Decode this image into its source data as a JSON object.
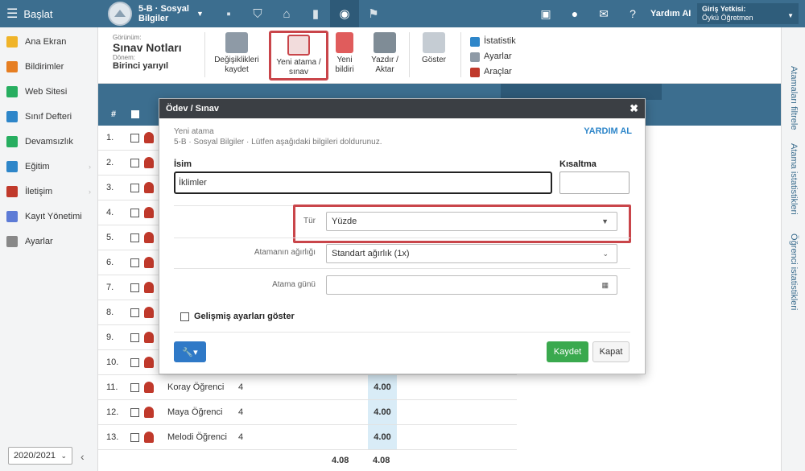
{
  "topbar": {
    "menu_label": "Başlat",
    "class_name": "5-B · Sosyal Bilgiler",
    "help_label": "Yardım AI",
    "user_label": "Giriş Yetkisi:",
    "user_name": "Öykü Öğretmen"
  },
  "sidebar": {
    "items": [
      {
        "label": "Ana Ekran",
        "icon": "star-icon",
        "color": "#f0b429"
      },
      {
        "label": "Bildirimler",
        "icon": "mail-icon",
        "color": "#e67e22"
      },
      {
        "label": "Web Sitesi",
        "icon": "home-icon",
        "color": "#27ae60"
      },
      {
        "label": "Sınıf Defteri",
        "icon": "notebook-icon",
        "color": "#2e86c9"
      },
      {
        "label": "Devamsızlık",
        "icon": "user-icon",
        "color": "#27ae60"
      },
      {
        "label": "Eğitim",
        "icon": "book-icon",
        "color": "#2e86c9"
      },
      {
        "label": "İletişim",
        "icon": "chat-icon",
        "color": "#c0392b"
      },
      {
        "label": "Kayıt Yönetimi",
        "icon": "pen-icon",
        "color": "#5d7bd6"
      },
      {
        "label": "Ayarlar",
        "icon": "gear-icon",
        "color": "#888888"
      }
    ],
    "school_year": "2020/2021"
  },
  "toolbar": {
    "view_label": "Görünüm:",
    "view_value": "Sınav Notları",
    "period_label": "Dönem:",
    "period_value": "Birinci yarıyıl",
    "save_label": "Değişiklikleri kaydet",
    "new_assignment_label": "Yeni atama / sınav",
    "new_notice_label": "Yeni bildiri",
    "print_label": "Yazdır / Aktar",
    "show_label": "Göster",
    "side_items": [
      "İstatistik",
      "Ayarlar",
      "Araçlar"
    ]
  },
  "right_panel": {
    "items": [
      "Atamaları filtrele",
      "Atama istatistikleri",
      "Öğrenci istatistikleri"
    ]
  },
  "grid": {
    "header_num": "#",
    "rows": [
      {
        "num": "1.",
        "name": "",
        "v1": "",
        "v2": ""
      },
      {
        "num": "2.",
        "name": "",
        "v1": "",
        "v2": ""
      },
      {
        "num": "3.",
        "name": "",
        "v1": "",
        "v2": ""
      },
      {
        "num": "4.",
        "name": "",
        "v1": "",
        "v2": ""
      },
      {
        "num": "5.",
        "name": "",
        "v1": "",
        "v2": ""
      },
      {
        "num": "6.",
        "name": "",
        "v1": "",
        "v2": ""
      },
      {
        "num": "7.",
        "name": "",
        "v1": "",
        "v2": ""
      },
      {
        "num": "8.",
        "name": "",
        "v1": "",
        "v2": ""
      },
      {
        "num": "9.",
        "name": "",
        "v1": "",
        "v2": ""
      },
      {
        "num": "10.",
        "name": "",
        "v1": "",
        "v2": ""
      },
      {
        "num": "11.",
        "name": "Koray Öğrenci",
        "v1": "4",
        "v2": "4.00"
      },
      {
        "num": "12.",
        "name": "Maya Öğrenci",
        "v1": "4",
        "v2": "4.00"
      },
      {
        "num": "13.",
        "name": "Melodi Öğrenci",
        "v1": "4",
        "v2": "4.00"
      }
    ],
    "footer_avg1": "4.08",
    "footer_avg2": "4.08"
  },
  "modal": {
    "title": "Ödev / Sınav",
    "subtitle": "Yeni atama",
    "description": "5-B · Sosyal Bilgiler · Lütfen aşağıdaki bilgileri doldurunuz.",
    "help": "YARDIM AL",
    "name_label": "İsim",
    "name_value": "İklimler",
    "short_label": "Kısaltma",
    "short_value": "",
    "type_label": "Tür",
    "type_value": "Yüzde",
    "weight_label": "Atamanın ağırlığı",
    "weight_value": "Standart ağırlık (1x)",
    "date_label": "Atama günü",
    "date_value": "",
    "advanced_label": "Gelişmiş ayarları göster",
    "save_label": "Kaydet",
    "close_label": "Kapat"
  }
}
